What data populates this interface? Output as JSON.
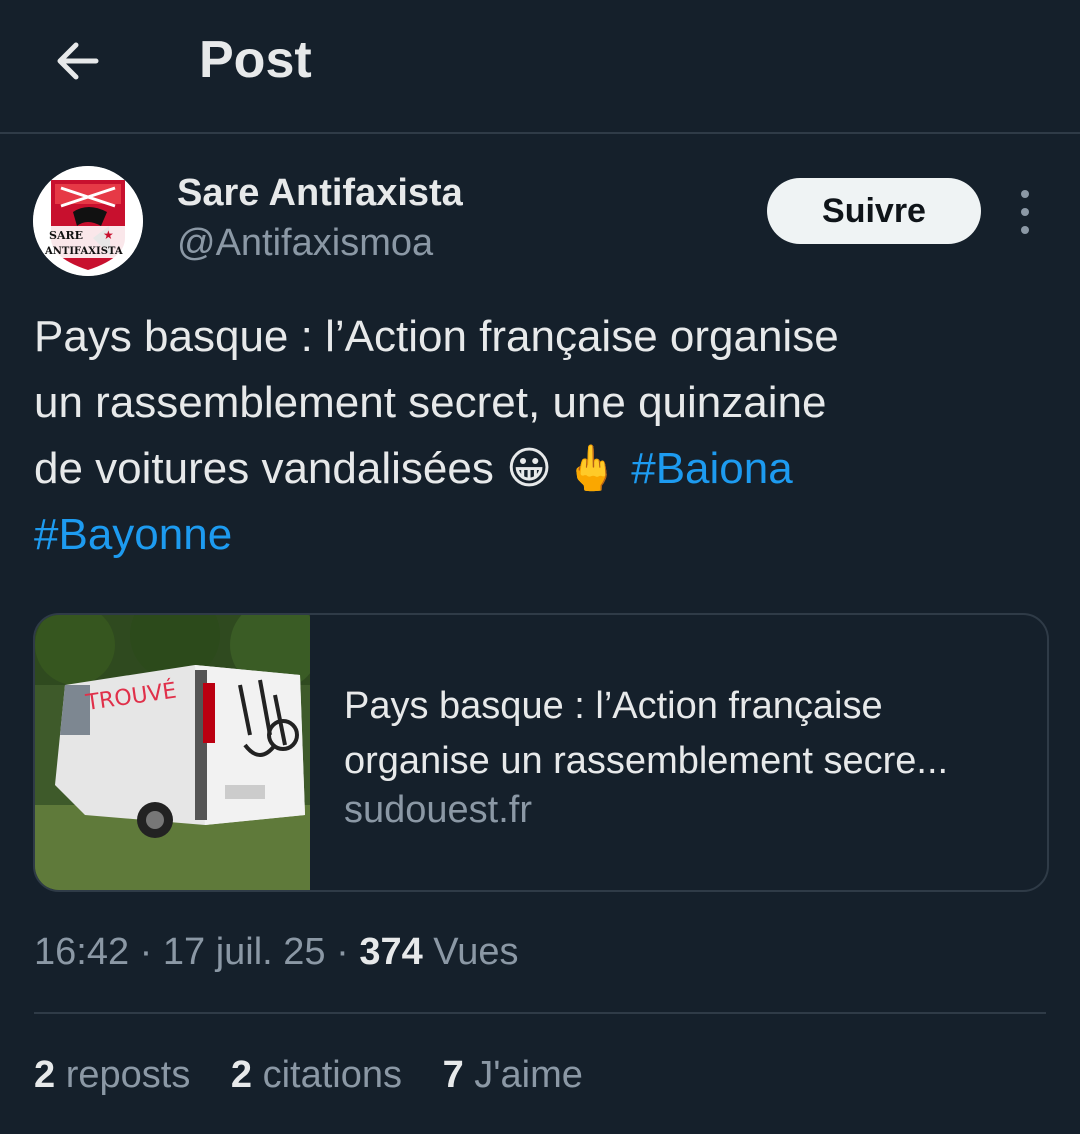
{
  "header": {
    "title": "Post",
    "back_icon": "arrow-left-icon"
  },
  "author": {
    "name": "Sare Antifaxista",
    "handle": "@Antifaxismoa",
    "avatar_text_top": "SARE",
    "avatar_text_bottom": "ANTIFAXISTA",
    "follow_label": "Suivre"
  },
  "tweet": {
    "line1": "Pays basque : l’Action française organise",
    "line2": "un rassemblement secret, une quinzaine",
    "line3": "de voitures vandalisées",
    "emoji1": "😀",
    "emoji2": "🖕",
    "hashtag1": "#Baiona",
    "hashtag2": "#Bayonne"
  },
  "link_card": {
    "title_line1": "Pays basque : l’Action française",
    "title_line2": "organise un rassemblement secre...",
    "domain": "sudouest.fr",
    "image_graffiti": "TROUVÉ"
  },
  "meta": {
    "time": "16:42",
    "sep1": "·",
    "date": "17 juil. 25",
    "sep2": "·",
    "views_count": "374",
    "views_label": "Vues"
  },
  "stats": {
    "reposts_count": "2",
    "reposts_label": "reposts",
    "quotes_count": "2",
    "quotes_label": "citations",
    "likes_count": "7",
    "likes_label": "J'aime"
  },
  "colors": {
    "background": "#15202b",
    "text": "#e7e9ea",
    "secondary": "#8b98a5",
    "link": "#1d9bf0",
    "divider": "#2f3b47"
  }
}
